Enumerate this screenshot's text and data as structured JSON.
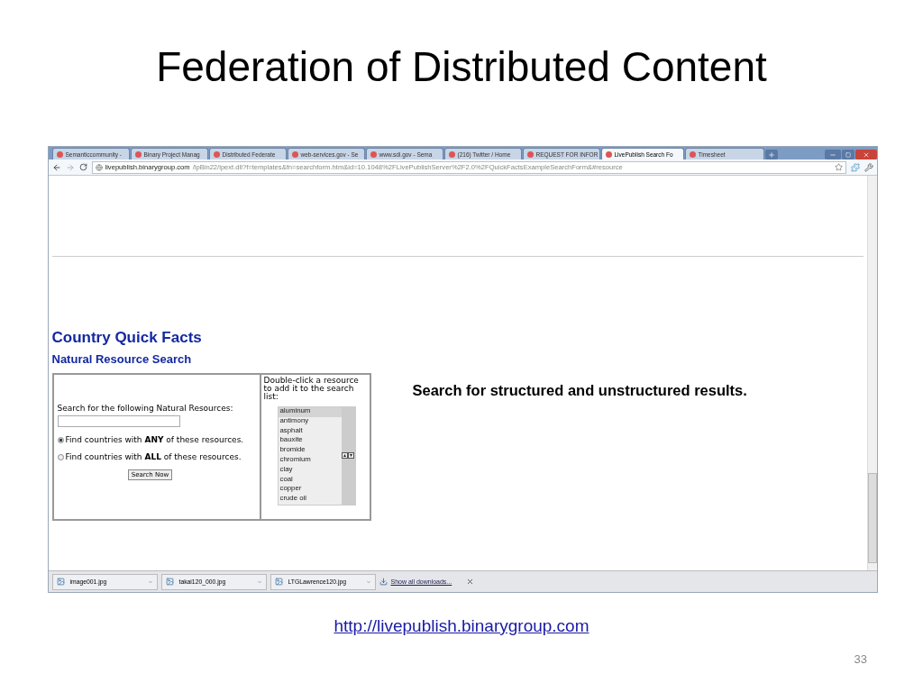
{
  "slide": {
    "title": "Federation of Distributed Content",
    "caption": "Search for structured and unstructured results.",
    "link": "http://livepublish.binarygroup.com",
    "page_number": "33"
  },
  "browser": {
    "tabs": [
      {
        "label": "Semanticcommunity -",
        "selected": false
      },
      {
        "label": "Binary Project Manag",
        "selected": false
      },
      {
        "label": "Distributed Federate",
        "selected": false
      },
      {
        "label": "web-services.gov - Se",
        "selected": false
      },
      {
        "label": "www.sdi.gov - Sema",
        "selected": false
      },
      {
        "label": "(216) Twitter / Home",
        "selected": false
      },
      {
        "label": "REQUEST FOR INFOR",
        "selected": false
      },
      {
        "label": "LivePublish Search Fo",
        "selected": true
      },
      {
        "label": "Timesheet",
        "selected": false
      }
    ],
    "url_host": "livepublish.binarygroup.com",
    "url_path": "/lpBin22/lpext.dll?f=templates&fn=searchform.htm&id=10.1048%2FLivePublishServer%2F2.0%2FQuickFactsExampleSearchForm&#resource"
  },
  "page": {
    "heading": "Country Quick Facts",
    "subheading": "Natural Resource Search",
    "search_label": "Search for the following Natural Resources:",
    "options": [
      {
        "label": "Find countries with **ANY** of these resources.",
        "selected": true
      },
      {
        "label": "Find countries with **ALL** of these resources.",
        "selected": false
      }
    ],
    "search_button": "Search Now",
    "list_hint": "Double-click a resource to add it to the search list:",
    "resources": [
      {
        "label": "aluminum",
        "selected": true
      },
      {
        "label": "antimony",
        "selected": false
      },
      {
        "label": "asphalt",
        "selected": false
      },
      {
        "label": "bauxite",
        "selected": false
      },
      {
        "label": "bromide",
        "selected": false
      },
      {
        "label": "chromium",
        "selected": false
      },
      {
        "label": "clay",
        "selected": false
      },
      {
        "label": "coal",
        "selected": false
      },
      {
        "label": "copper",
        "selected": false
      },
      {
        "label": "crude oil",
        "selected": false
      }
    ]
  },
  "downloads": {
    "items": [
      "image001.jpg",
      "takai120_000.jpg",
      "LTGLawrence120.jpg"
    ],
    "show_all": "Show all downloads..."
  }
}
